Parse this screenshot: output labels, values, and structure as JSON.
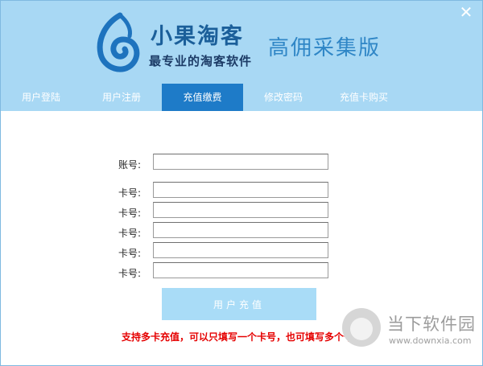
{
  "window": {
    "close_symbol": "✕"
  },
  "header": {
    "brand_name": "小果淘客",
    "slogan": "最专业的淘客软件",
    "edition": "高佣采集版",
    "logo_icon": "swirl-logo-icon"
  },
  "tabs": [
    {
      "label": "用户登陆",
      "active": false
    },
    {
      "label": "用户注册",
      "active": false
    },
    {
      "label": "充值缴费",
      "active": true
    },
    {
      "label": "修改密码",
      "active": false
    },
    {
      "label": "充值卡购买",
      "active": false
    }
  ],
  "form": {
    "account_label": "账号:",
    "account_value": "",
    "card_label": "卡号:",
    "cards": [
      "",
      "",
      "",
      "",
      ""
    ],
    "submit_label": "用户充值",
    "notice": "支持多卡充值，可以只填写一个卡号，也可填写多个卡号!"
  },
  "watermark": {
    "title": "当下软件园",
    "url": "www.downxia.com"
  },
  "colors": {
    "header_bg": "#a8d8f4",
    "active_tab": "#1e7bc8",
    "submit_bg": "#a9dcf7",
    "notice": "#e50000"
  }
}
